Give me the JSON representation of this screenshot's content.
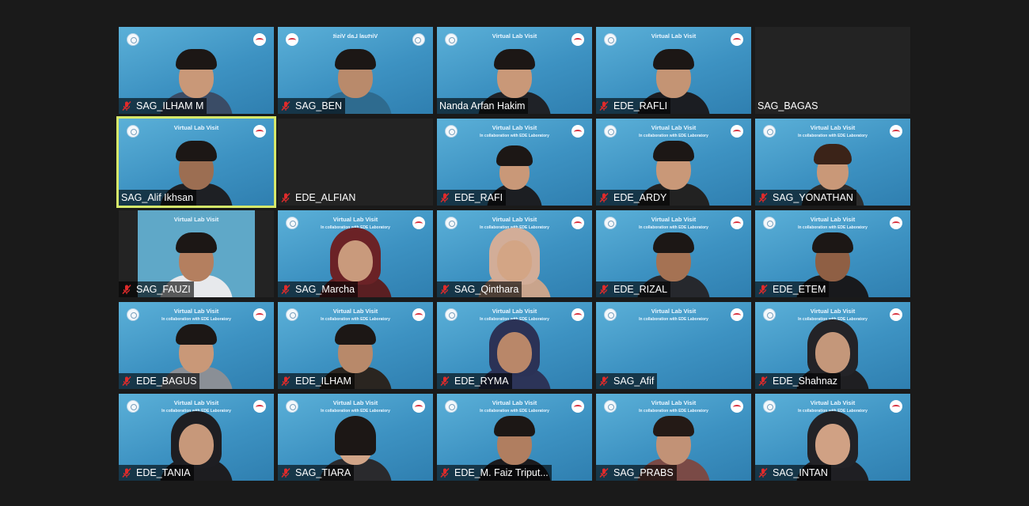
{
  "meeting": {
    "banner_title": "Virtual Lab Visit",
    "banner_subtitle": "In collaboration with EDE Laboratory",
    "colors": {
      "background": "#1a1a1a",
      "active_speaker": "#d6e86a",
      "muted_icon": "#e02b2b",
      "tile_blue": "#4aa3d1"
    },
    "participants": [
      {
        "name": "SAG_ILHAM M",
        "muted": true
      },
      {
        "name": "SAG_BEN",
        "muted": true
      },
      {
        "name": "Nanda Arfan Hakim",
        "muted": false
      },
      {
        "name": "EDE_RAFLI",
        "muted": true
      },
      {
        "name": "SAG_BAGAS",
        "muted": false
      },
      {
        "name": "SAG_Alif Ikhsan",
        "muted": false
      },
      {
        "name": "EDE_ALFIAN",
        "muted": true
      },
      {
        "name": "EDE_RAFI",
        "muted": true
      },
      {
        "name": "EDE_ARDY",
        "muted": true
      },
      {
        "name": "SAG_YONATHAN",
        "muted": true
      },
      {
        "name": "SAG_FAUZI",
        "muted": true
      },
      {
        "name": "SAG_Marcha",
        "muted": true
      },
      {
        "name": "SAG_Qinthara",
        "muted": true
      },
      {
        "name": "EDE_RIZAL",
        "muted": true
      },
      {
        "name": "EDE_ETEM",
        "muted": true
      },
      {
        "name": "EDE_BAGUS",
        "muted": true
      },
      {
        "name": "EDE_ILHAM",
        "muted": true
      },
      {
        "name": "EDE_RYMA",
        "muted": true
      },
      {
        "name": "SAG_Afif",
        "muted": true
      },
      {
        "name": "EDE_Shahnaz",
        "muted": true
      },
      {
        "name": "EDE_TANIA",
        "muted": true
      },
      {
        "name": "SAG_TIARA",
        "muted": true
      },
      {
        "name": "EDE_M. Faiz Triput...",
        "muted": true
      },
      {
        "name": "SAG_PRABS",
        "muted": true
      },
      {
        "name": "SAG_INTAN",
        "muted": true
      }
    ]
  }
}
